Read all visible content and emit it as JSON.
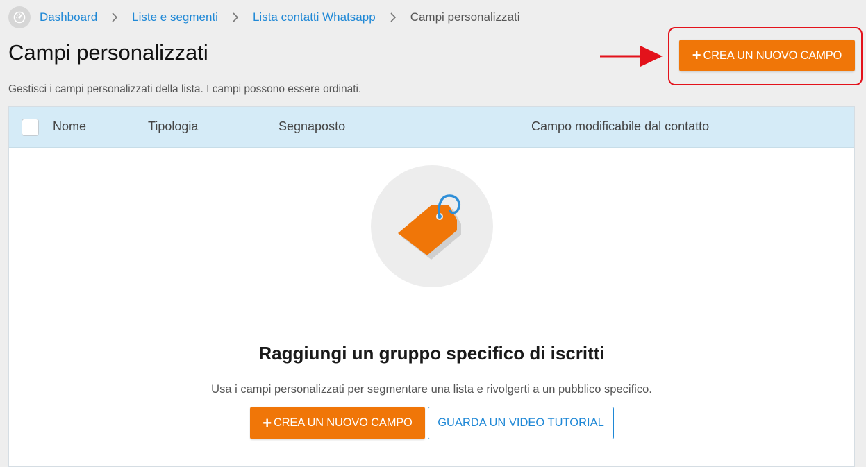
{
  "breadcrumb": {
    "home_icon": "dashboard-gauge-icon",
    "items": [
      {
        "label": "Dashboard"
      },
      {
        "label": "Liste e segmenti"
      },
      {
        "label": "Lista contatti Whatsapp"
      },
      {
        "label": "Campi personalizzati"
      }
    ],
    "separator_icon": "chevron-right-icon"
  },
  "header": {
    "title": "Campi personalizzati",
    "subtitle": "Gestisci i campi personalizzati della lista. I campi possono essere ordinati.",
    "create_button": {
      "plus": "+",
      "label": "CREA UN NUOVO CAMPO"
    }
  },
  "annotation": {
    "arrow_color": "#e3121b",
    "box_color": "#e3121b"
  },
  "table": {
    "columns": [
      "Nome",
      "Tipologia",
      "Segnaposto",
      "Campo modificabile dal contatto"
    ],
    "header_bg": "#d5ebf7"
  },
  "empty_state": {
    "icon": "price-tag-icon",
    "title": "Raggiungi un gruppo specifico di iscritti",
    "text": "Usa i campi personalizzati per segmentare una lista e rivolgerti a un pubblico specifico.",
    "primary_button": {
      "plus": "+",
      "label": "CREA UN NUOVO CAMPO"
    },
    "secondary_button": {
      "label": "GUARDA UN VIDEO TUTORIAL"
    }
  },
  "colors": {
    "accent_orange": "#f07608",
    "link_blue": "#1f88d6",
    "tag_blue": "#2f8fd8"
  }
}
